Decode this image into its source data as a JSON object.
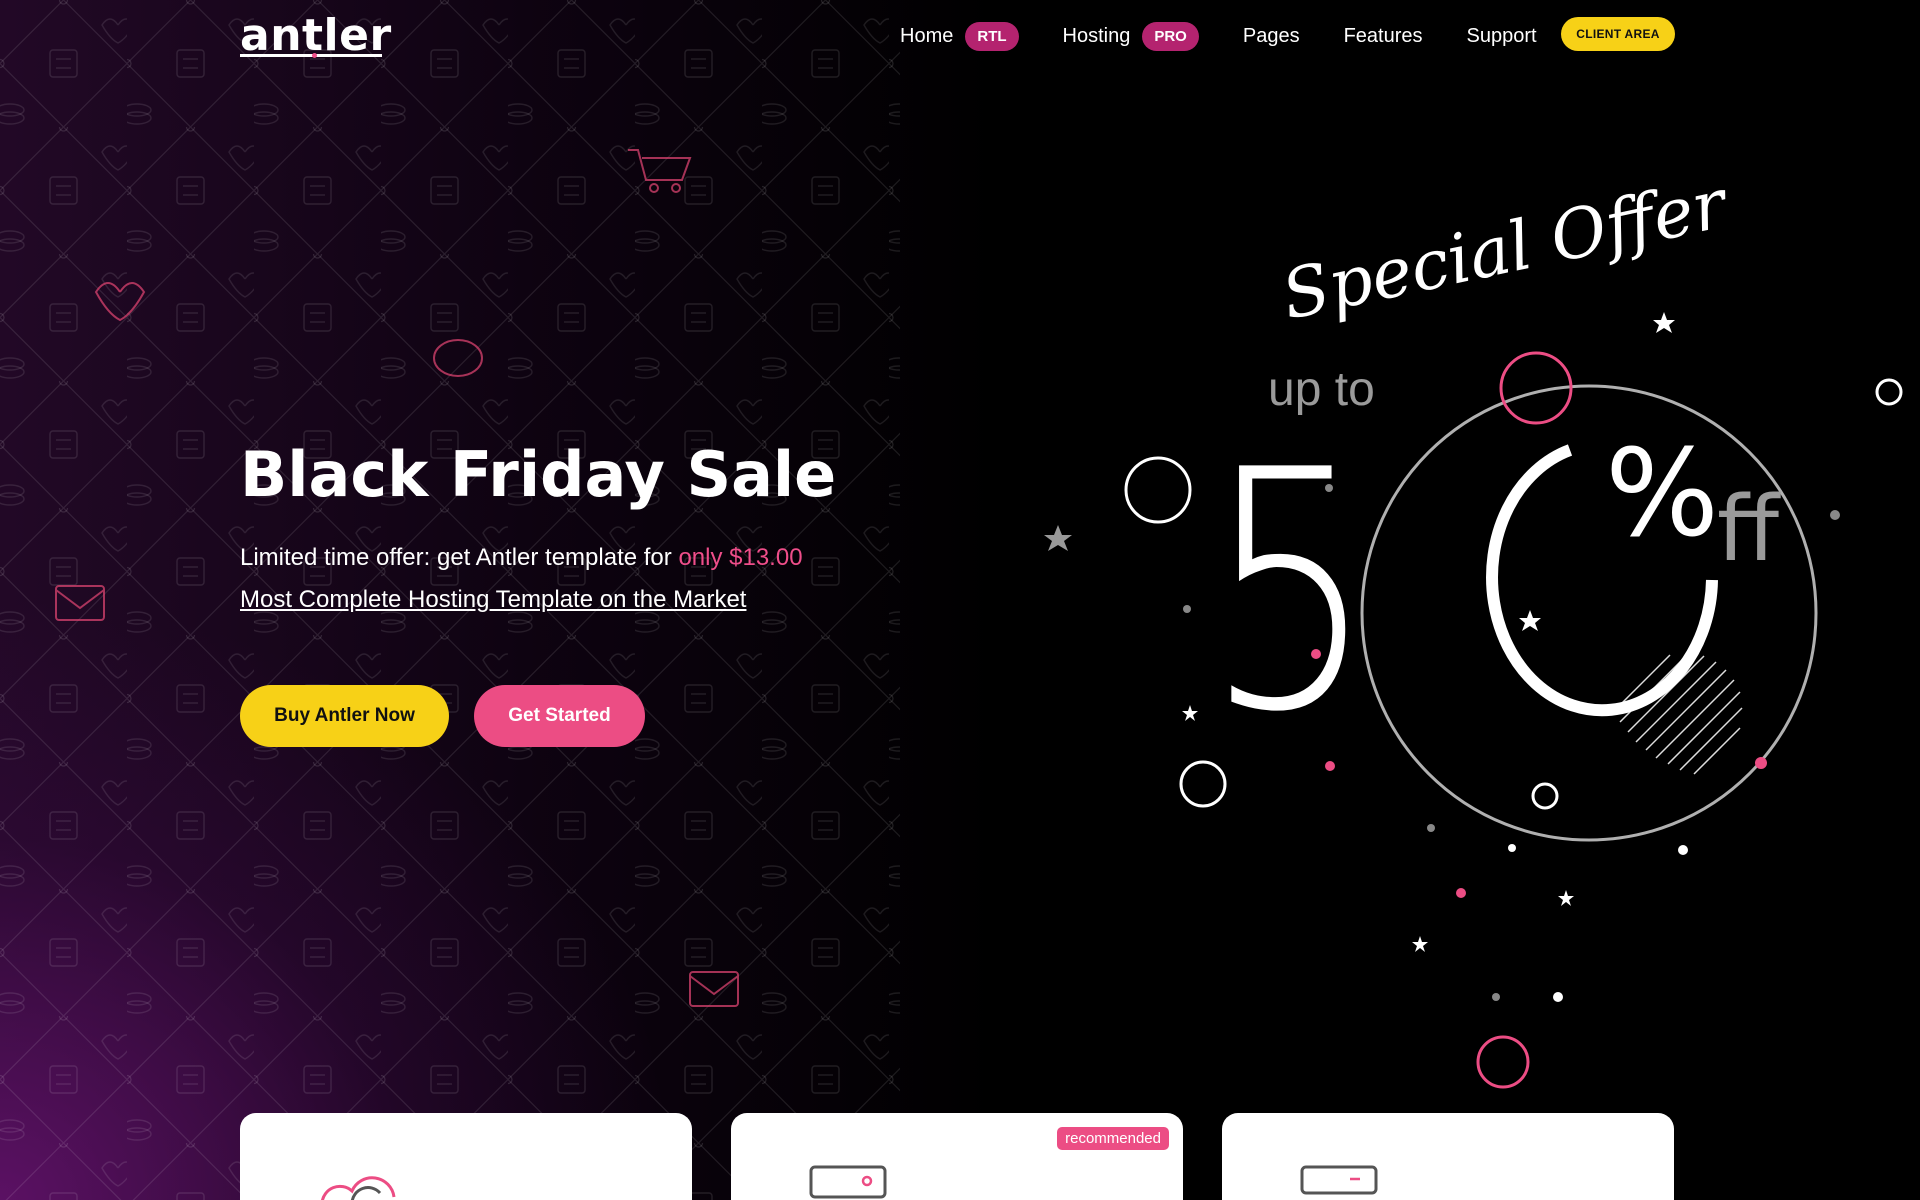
{
  "brand": {
    "logo_text": "antler"
  },
  "nav": {
    "items": [
      {
        "label": "Home",
        "badge": "RTL"
      },
      {
        "label": "Hosting",
        "badge": "PRO"
      },
      {
        "label": "Pages",
        "badge": null
      },
      {
        "label": "Features",
        "badge": null
      },
      {
        "label": "Support",
        "badge": null
      }
    ],
    "client_area_label": "CLIENT AREA"
  },
  "hero": {
    "title": "Black Friday Sale",
    "offer_text": "Limited time offer: get Antler template for ",
    "offer_price": "only $13.00",
    "tagline": "Most Complete Hosting Template on the Market",
    "buy_button": "Buy Antler Now",
    "start_button": "Get Started"
  },
  "offer": {
    "heading": "Special Offer",
    "up_to": "up to",
    "number_5": "5",
    "number_0": "0",
    "percent": "%",
    "off": "ff"
  },
  "cards": [
    {
      "badge": null,
      "icon": "cloud-icon"
    },
    {
      "badge": "recommended",
      "icon": "server-icon"
    },
    {
      "badge": null,
      "icon": "dedicated-server-icon"
    }
  ],
  "colors": {
    "accent_yellow": "#f7d117",
    "accent_pink": "#ec4d84",
    "badge_magenta": "#b4236f",
    "background": "#000000"
  }
}
